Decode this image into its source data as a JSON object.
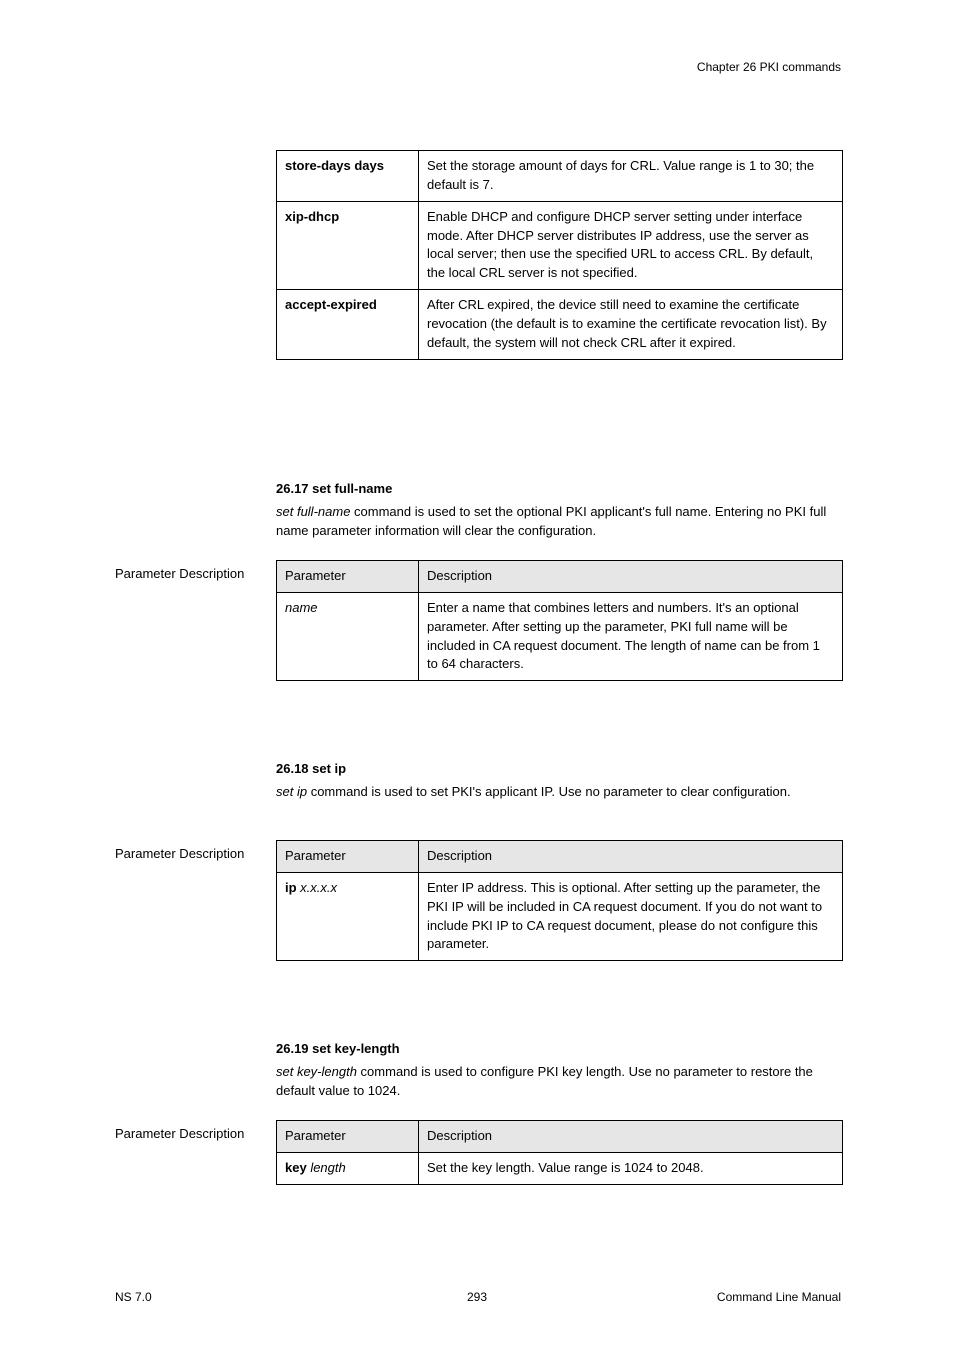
{
  "header": {
    "right": "Chapter 26 PKI commands"
  },
  "block1": {
    "rows": [
      {
        "param": "store-days days",
        "desc": "Set the storage amount of days for CRL. Value range is 1 to 30; the default is 7."
      },
      {
        "param": "xip-dhcp",
        "desc": "Enable DHCP and configure DHCP server setting under interface mode. After DHCP server distributes IP address, use the server as local server; then use the specified URL to access CRL. By default, the local CRL server is not specified."
      },
      {
        "param": "accept-expired",
        "desc": "After CRL expired, the device still need to examine the certificate revocation (the default is to examine the certificate revocation list). By default, the system will not check CRL after it expired."
      }
    ]
  },
  "section2": {
    "bold": "26.17 set full-name",
    "italic": "set full-name",
    "desc": " command is used to set the optional PKI applicant's full name. Entering no PKI full name parameter information will clear the configuration.",
    "table": {
      "headers": [
        "Parameter",
        "Description"
      ],
      "rows": [
        {
          "param": "name",
          "desc": "Enter a name that combines letters and numbers. It's an optional parameter. After setting up the parameter, PKI full name will be included in CA request document. The length of name can be from 1 to 64 characters."
        }
      ]
    }
  },
  "section3": {
    "bold": "26.18 set ip",
    "italic": "set ip",
    "desc": " command is used to set PKI's applicant IP. Use no parameter to clear configuration.",
    "table": {
      "headers": [
        "Parameter",
        "Description"
      ],
      "rows": [
        {
          "param": "ip x.x.x.x",
          "desc": "Enter IP address. This is optional. After setting up the parameter, the PKI IP will be included in CA request document. If you do not want to include PKI IP to CA request document, please do not configure this parameter."
        }
      ]
    }
  },
  "section4": {
    "bold": "26.19 set key-length",
    "italic": "set key-length",
    "desc": " command is used to configure PKI key length. Use no parameter to restore the default value to 1024.",
    "table": {
      "headers": [
        "Parameter",
        "Description"
      ],
      "rows": [
        {
          "param": "key length",
          "desc": "Set the key length. Value range is 1024 to 2048."
        }
      ]
    }
  },
  "footer": {
    "left": "NS 7.0",
    "center": "293",
    "right": "Command Line Manual"
  }
}
